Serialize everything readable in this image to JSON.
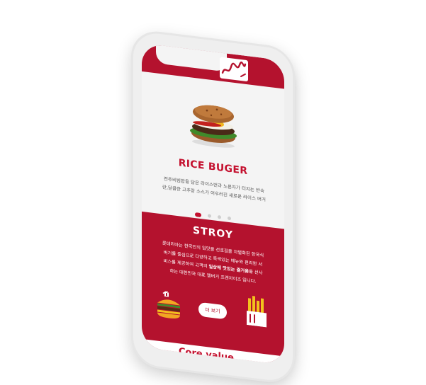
{
  "brand": {
    "primary_color": "#b4122e",
    "accent_color": "#c4112f"
  },
  "product": {
    "title": "RICE BUGER",
    "description_line1": "전주비빔밥을 담은 라이스번과 노른자가 터지는 반숙",
    "description_line2": "란,달콤한 고추장 소스가 어우러진 새로운 라이스 버거"
  },
  "carousel": {
    "page_count": 4,
    "active_index": 0
  },
  "story": {
    "title": "STROY",
    "line1": "롯데리아는 한국인의 입맛을 선호점을 차별화된 한국식",
    "line2": "버거를 중심으로 다양하고 특색있는 메뉴와 편리한 서",
    "line3_pre": "비스를 제공하여 고객의 ",
    "line3_bold": "일상에 맛있는 즐거움",
    "line3_post": "을 선사",
    "line4": "하는 대한민국 대표 햄버거 프랜차이즈 입니다.",
    "more_button": "더 보기"
  },
  "core_value": {
    "label": "Core value"
  },
  "icons": {
    "logo": "brand-logo-icon",
    "burger_image": "rice-burger-image",
    "left_icon": "burger-stack-icon",
    "right_icon": "fries-icon"
  }
}
